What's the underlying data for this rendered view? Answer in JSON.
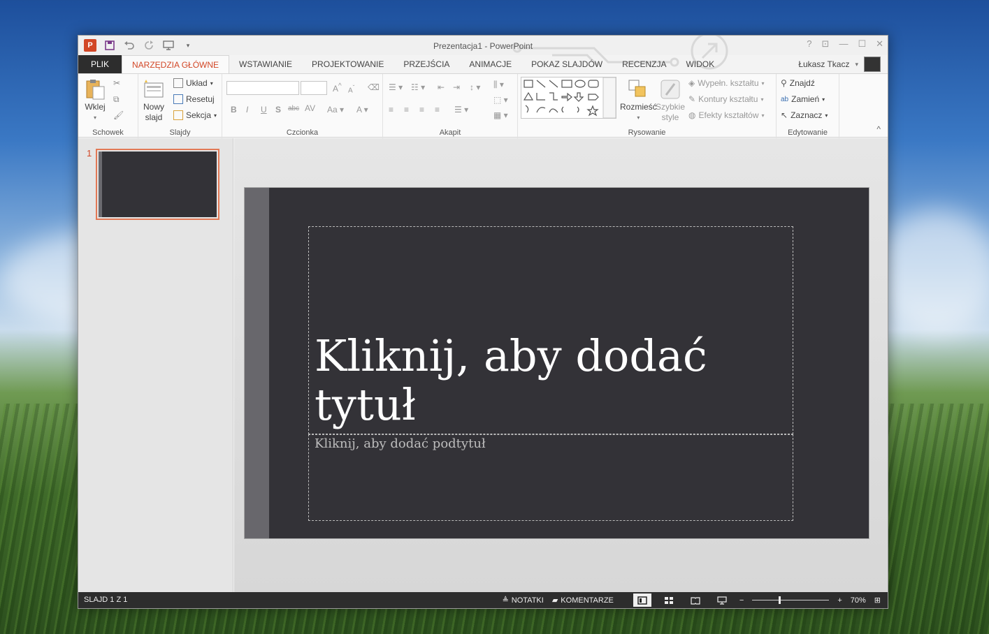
{
  "window": {
    "title": "Prezentacja1 - PowerPoint",
    "app_icon": "P"
  },
  "qat": {
    "save_icon": "save-icon",
    "undo_icon": "undo-icon",
    "redo_icon": "redo-icon",
    "start_icon": "from-start-icon"
  },
  "tabs": [
    {
      "label": "PLIK"
    },
    {
      "label": "NARZĘDZIA GŁÓWNE"
    },
    {
      "label": "WSTAWIANIE"
    },
    {
      "label": "PROJEKTOWANIE"
    },
    {
      "label": "PRZEJŚCIA"
    },
    {
      "label": "ANIMACJE"
    },
    {
      "label": "POKAZ SLAJDÓW"
    },
    {
      "label": "RECENZJA"
    },
    {
      "label": "WIDOK"
    }
  ],
  "user": {
    "name": "Łukasz Tkacz"
  },
  "ribbon": {
    "clipboard": {
      "label": "Schowek",
      "paste": "Wklej"
    },
    "slides": {
      "label": "Slajdy",
      "new_slide_1": "Nowy",
      "new_slide_2": "slajd",
      "layout": "Układ",
      "reset": "Resetuj",
      "section": "Sekcja"
    },
    "font": {
      "label": "Czcionka"
    },
    "paragraph": {
      "label": "Akapit"
    },
    "drawing": {
      "label": "Rysowanie",
      "arrange": "Rozmieść",
      "quick_styles_1": "Szybkie",
      "quick_styles_2": "style",
      "fill": "Wypełn. kształtu",
      "outline": "Kontury kształtu",
      "effects": "Efekty kształtów"
    },
    "editing": {
      "label": "Edytowanie",
      "find": "Znajdź",
      "replace": "Zamień",
      "select": "Zaznacz"
    }
  },
  "thumbnails": [
    {
      "number": "1"
    }
  ],
  "slide": {
    "title_placeholder": "Kliknij, aby dodać tytuł",
    "subtitle_placeholder": "Kliknij, aby dodać podtytuł"
  },
  "status": {
    "slide_info": "SLAJD 1 Z 1",
    "notes": "NOTATKI",
    "comments": "KOMENTARZE",
    "zoom": "70%",
    "zoom_level": 0.7
  },
  "colors": {
    "accent": "#d24726",
    "slide_bg": "#333237",
    "status_bg": "#2d2d2d"
  }
}
